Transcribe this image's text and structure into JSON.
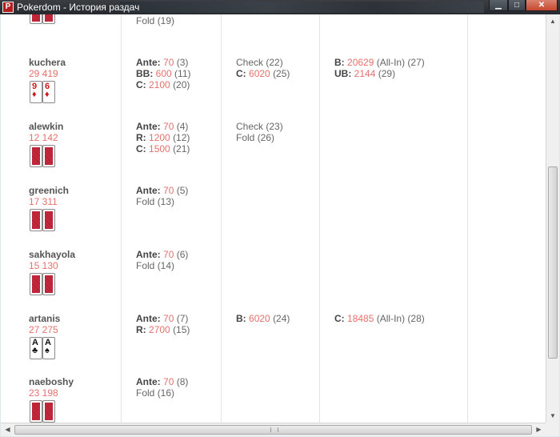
{
  "window": {
    "title": "Pokerdom - История раздач",
    "icon_letter": "P",
    "minimize_glyph": "▁",
    "maximize_glyph": "□",
    "close_glyph": "✕"
  },
  "colors": {
    "stack": "#e8706c",
    "titlebar": "#2f3337",
    "close": "#c7472f"
  },
  "top_partial": {
    "preflop": {
      "text": "Fold",
      "seq": "(19)"
    }
  },
  "players": [
    {
      "name": "kuchera",
      "stack": "29 419",
      "cards": [
        {
          "rank": "9",
          "suit": "♦",
          "color": "red"
        },
        {
          "rank": "6",
          "suit": "♦",
          "color": "red"
        }
      ],
      "preflop": [
        {
          "label": "Ante:",
          "value": "70",
          "seq": "(3)"
        },
        {
          "label": "BB:",
          "value": "600",
          "seq": "(11)"
        },
        {
          "label": "C:",
          "value": "2100",
          "seq": "(20)"
        }
      ],
      "flop": [
        {
          "text": "Check",
          "seq": "(22)"
        },
        {
          "label": "C:",
          "value": "6020",
          "seq": "(25)"
        }
      ],
      "turn": [
        {
          "label": "B:",
          "value": "20629",
          "extra": "(All-In)",
          "seq": "(27)"
        },
        {
          "label": "UB:",
          "value": "2144",
          "seq": "(29)"
        }
      ]
    },
    {
      "name": "alewkin",
      "stack": "12 142",
      "cards": "hidden",
      "preflop": [
        {
          "label": "Ante:",
          "value": "70",
          "seq": "(4)"
        },
        {
          "label": "R:",
          "value": "1200",
          "seq": "(12)"
        },
        {
          "label": "C:",
          "value": "1500",
          "seq": "(21)"
        }
      ],
      "flop": [
        {
          "text": "Check",
          "seq": "(23)"
        },
        {
          "text": "Fold",
          "seq": "(26)"
        }
      ]
    },
    {
      "name": "greenich",
      "stack": "17 311",
      "cards": "hidden",
      "preflop": [
        {
          "label": "Ante:",
          "value": "70",
          "seq": "(5)"
        },
        {
          "text": "Fold",
          "seq": "(13)"
        }
      ]
    },
    {
      "name": "sakhayola",
      "stack": "15 130",
      "cards": "hidden",
      "preflop": [
        {
          "label": "Ante:",
          "value": "70",
          "seq": "(6)"
        },
        {
          "text": "Fold",
          "seq": "(14)"
        }
      ]
    },
    {
      "name": "artanis",
      "stack": "27 275",
      "cards": [
        {
          "rank": "A",
          "suit": "♣",
          "color": "black"
        },
        {
          "rank": "A",
          "suit": "♠",
          "color": "black"
        }
      ],
      "preflop": [
        {
          "label": "Ante:",
          "value": "70",
          "seq": "(7)"
        },
        {
          "label": "R:",
          "value": "2700",
          "seq": "(15)"
        }
      ],
      "flop": [
        {
          "label": "B:",
          "value": "6020",
          "seq": "(24)"
        }
      ],
      "turn": [
        {
          "label": "C:",
          "value": "18485",
          "extra": "(All-In)",
          "seq": "(28)"
        }
      ]
    },
    {
      "name": "naeboshy",
      "stack": "23 198",
      "cards": "hidden",
      "preflop": [
        {
          "label": "Ante:",
          "value": "70",
          "seq": "(8)"
        },
        {
          "text": "Fold",
          "seq": "(16)"
        }
      ]
    }
  ]
}
